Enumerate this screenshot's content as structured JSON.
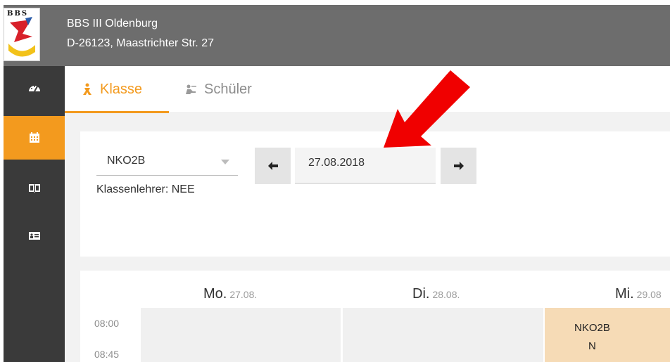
{
  "header": {
    "logo_text": "BBS",
    "school_name": "BBS III Oldenburg",
    "address": "D-26123, Maastrichter Str. 27",
    "bg_color": "#6d6d6d"
  },
  "sidebar": {
    "items": [
      {
        "icon": "dashboard-icon",
        "active": false
      },
      {
        "icon": "calendar-icon",
        "active": true
      },
      {
        "icon": "book-icon",
        "active": false
      },
      {
        "icon": "id-card-icon",
        "active": false
      }
    ],
    "active_color": "#f39a1e",
    "bg_color": "#3a3a3a"
  },
  "tabs": [
    {
      "label": "Klasse",
      "icon": "class-icon",
      "active": true
    },
    {
      "label": "Schüler",
      "icon": "student-icon",
      "active": false
    }
  ],
  "filter": {
    "class_value": "NKO2B",
    "teacher_label": "Klassenlehrer: NEE",
    "date_value": "27.08.2018"
  },
  "calendar": {
    "days": [
      {
        "name": "Mo.",
        "date": "27.08."
      },
      {
        "name": "Di.",
        "date": "28.08."
      },
      {
        "name": "Mi.",
        "date": "29.08"
      }
    ],
    "times": [
      "08:00",
      "08:45"
    ],
    "lesson": {
      "class": "NKO2B",
      "subject": "N",
      "color": "#f6dbb6"
    }
  },
  "annotation": {
    "arrow_color": "#f00000"
  }
}
